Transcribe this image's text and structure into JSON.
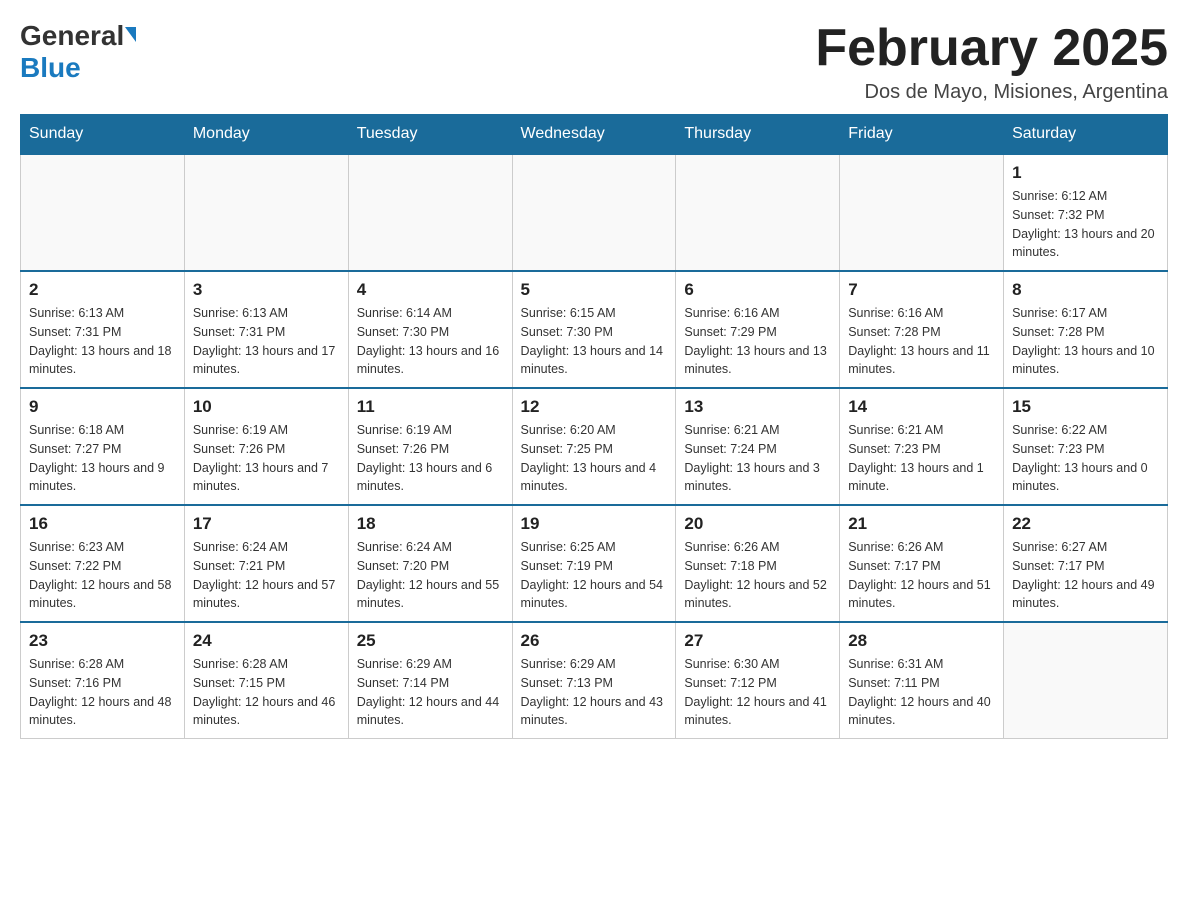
{
  "header": {
    "logo_general": "General",
    "logo_blue": "Blue",
    "month_title": "February 2025",
    "subtitle": "Dos de Mayo, Misiones, Argentina"
  },
  "days_of_week": [
    "Sunday",
    "Monday",
    "Tuesday",
    "Wednesday",
    "Thursday",
    "Friday",
    "Saturday"
  ],
  "weeks": [
    [
      {
        "day": "",
        "info": ""
      },
      {
        "day": "",
        "info": ""
      },
      {
        "day": "",
        "info": ""
      },
      {
        "day": "",
        "info": ""
      },
      {
        "day": "",
        "info": ""
      },
      {
        "day": "",
        "info": ""
      },
      {
        "day": "1",
        "info": "Sunrise: 6:12 AM\nSunset: 7:32 PM\nDaylight: 13 hours and 20 minutes."
      }
    ],
    [
      {
        "day": "2",
        "info": "Sunrise: 6:13 AM\nSunset: 7:31 PM\nDaylight: 13 hours and 18 minutes."
      },
      {
        "day": "3",
        "info": "Sunrise: 6:13 AM\nSunset: 7:31 PM\nDaylight: 13 hours and 17 minutes."
      },
      {
        "day": "4",
        "info": "Sunrise: 6:14 AM\nSunset: 7:30 PM\nDaylight: 13 hours and 16 minutes."
      },
      {
        "day": "5",
        "info": "Sunrise: 6:15 AM\nSunset: 7:30 PM\nDaylight: 13 hours and 14 minutes."
      },
      {
        "day": "6",
        "info": "Sunrise: 6:16 AM\nSunset: 7:29 PM\nDaylight: 13 hours and 13 minutes."
      },
      {
        "day": "7",
        "info": "Sunrise: 6:16 AM\nSunset: 7:28 PM\nDaylight: 13 hours and 11 minutes."
      },
      {
        "day": "8",
        "info": "Sunrise: 6:17 AM\nSunset: 7:28 PM\nDaylight: 13 hours and 10 minutes."
      }
    ],
    [
      {
        "day": "9",
        "info": "Sunrise: 6:18 AM\nSunset: 7:27 PM\nDaylight: 13 hours and 9 minutes."
      },
      {
        "day": "10",
        "info": "Sunrise: 6:19 AM\nSunset: 7:26 PM\nDaylight: 13 hours and 7 minutes."
      },
      {
        "day": "11",
        "info": "Sunrise: 6:19 AM\nSunset: 7:26 PM\nDaylight: 13 hours and 6 minutes."
      },
      {
        "day": "12",
        "info": "Sunrise: 6:20 AM\nSunset: 7:25 PM\nDaylight: 13 hours and 4 minutes."
      },
      {
        "day": "13",
        "info": "Sunrise: 6:21 AM\nSunset: 7:24 PM\nDaylight: 13 hours and 3 minutes."
      },
      {
        "day": "14",
        "info": "Sunrise: 6:21 AM\nSunset: 7:23 PM\nDaylight: 13 hours and 1 minute."
      },
      {
        "day": "15",
        "info": "Sunrise: 6:22 AM\nSunset: 7:23 PM\nDaylight: 13 hours and 0 minutes."
      }
    ],
    [
      {
        "day": "16",
        "info": "Sunrise: 6:23 AM\nSunset: 7:22 PM\nDaylight: 12 hours and 58 minutes."
      },
      {
        "day": "17",
        "info": "Sunrise: 6:24 AM\nSunset: 7:21 PM\nDaylight: 12 hours and 57 minutes."
      },
      {
        "day": "18",
        "info": "Sunrise: 6:24 AM\nSunset: 7:20 PM\nDaylight: 12 hours and 55 minutes."
      },
      {
        "day": "19",
        "info": "Sunrise: 6:25 AM\nSunset: 7:19 PM\nDaylight: 12 hours and 54 minutes."
      },
      {
        "day": "20",
        "info": "Sunrise: 6:26 AM\nSunset: 7:18 PM\nDaylight: 12 hours and 52 minutes."
      },
      {
        "day": "21",
        "info": "Sunrise: 6:26 AM\nSunset: 7:17 PM\nDaylight: 12 hours and 51 minutes."
      },
      {
        "day": "22",
        "info": "Sunrise: 6:27 AM\nSunset: 7:17 PM\nDaylight: 12 hours and 49 minutes."
      }
    ],
    [
      {
        "day": "23",
        "info": "Sunrise: 6:28 AM\nSunset: 7:16 PM\nDaylight: 12 hours and 48 minutes."
      },
      {
        "day": "24",
        "info": "Sunrise: 6:28 AM\nSunset: 7:15 PM\nDaylight: 12 hours and 46 minutes."
      },
      {
        "day": "25",
        "info": "Sunrise: 6:29 AM\nSunset: 7:14 PM\nDaylight: 12 hours and 44 minutes."
      },
      {
        "day": "26",
        "info": "Sunrise: 6:29 AM\nSunset: 7:13 PM\nDaylight: 12 hours and 43 minutes."
      },
      {
        "day": "27",
        "info": "Sunrise: 6:30 AM\nSunset: 7:12 PM\nDaylight: 12 hours and 41 minutes."
      },
      {
        "day": "28",
        "info": "Sunrise: 6:31 AM\nSunset: 7:11 PM\nDaylight: 12 hours and 40 minutes."
      },
      {
        "day": "",
        "info": ""
      }
    ]
  ]
}
